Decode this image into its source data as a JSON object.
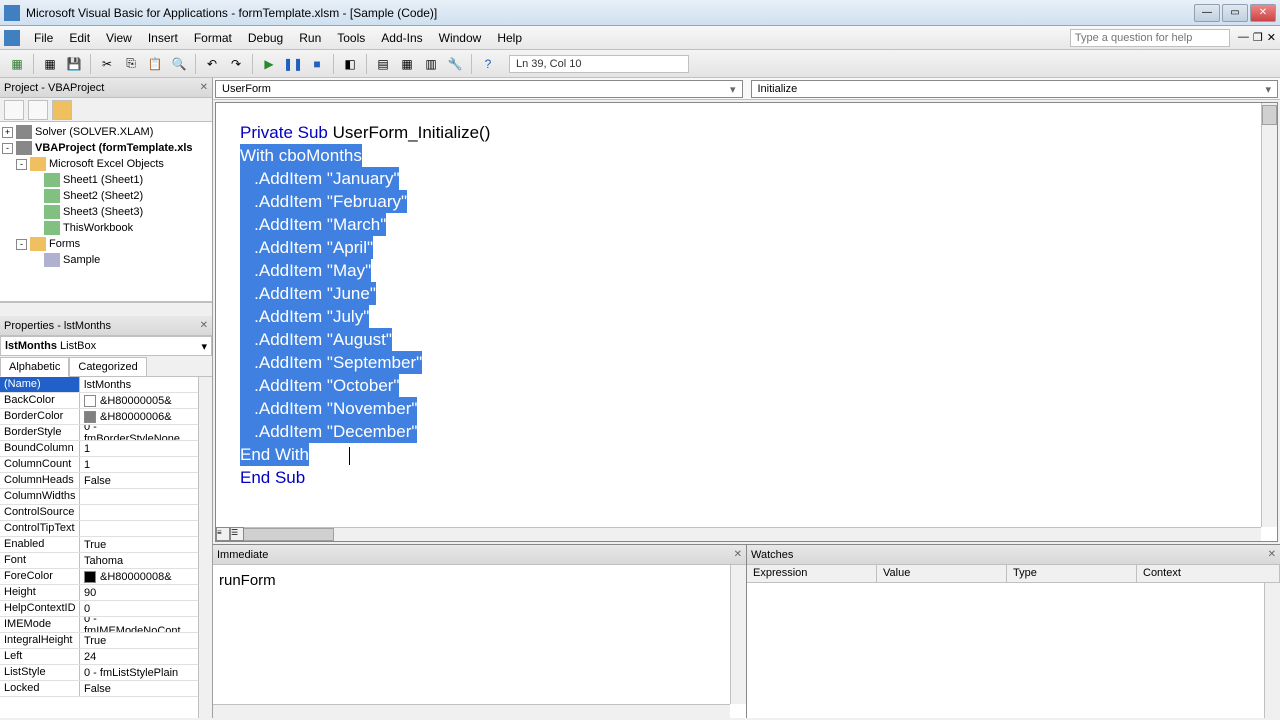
{
  "title": "Microsoft Visual Basic for Applications - formTemplate.xlsm - [Sample (Code)]",
  "menu": [
    "File",
    "Edit",
    "View",
    "Insert",
    "Format",
    "Debug",
    "Run",
    "Tools",
    "Add-Ins",
    "Window",
    "Help"
  ],
  "help_placeholder": "Type a question for help",
  "status": "Ln 39, Col 10",
  "project_panel": {
    "title": "Project - VBAProject"
  },
  "tree": [
    {
      "label": "Solver (SOLVER.XLAM)",
      "icon": "vba",
      "indent": 0,
      "exp": "+"
    },
    {
      "label": "VBAProject (formTemplate.xls",
      "icon": "vba",
      "indent": 0,
      "exp": "-",
      "bold": true
    },
    {
      "label": "Microsoft Excel Objects",
      "icon": "folder",
      "indent": 1,
      "exp": "-"
    },
    {
      "label": "Sheet1 (Sheet1)",
      "icon": "sheet",
      "indent": 2
    },
    {
      "label": "Sheet2 (Sheet2)",
      "icon": "sheet",
      "indent": 2
    },
    {
      "label": "Sheet3 (Sheet3)",
      "icon": "sheet",
      "indent": 2
    },
    {
      "label": "ThisWorkbook",
      "icon": "sheet",
      "indent": 2
    },
    {
      "label": "Forms",
      "icon": "folder",
      "indent": 1,
      "exp": "-"
    },
    {
      "label": "Sample",
      "icon": "form",
      "indent": 2
    }
  ],
  "props_panel": {
    "title": "Properties - lstMonths",
    "object": "lstMonths",
    "type": "ListBox"
  },
  "props_tabs": [
    "Alphabetic",
    "Categorized"
  ],
  "properties": [
    {
      "name": "(Name)",
      "value": "lstMonths",
      "selected": true
    },
    {
      "name": "BackColor",
      "value": "&H80000005&",
      "color": "#ffffff"
    },
    {
      "name": "BorderColor",
      "value": "&H80000006&",
      "color": "#808080"
    },
    {
      "name": "BorderStyle",
      "value": "0 - fmBorderStyleNone"
    },
    {
      "name": "BoundColumn",
      "value": "1"
    },
    {
      "name": "ColumnCount",
      "value": "1"
    },
    {
      "name": "ColumnHeads",
      "value": "False"
    },
    {
      "name": "ColumnWidths",
      "value": ""
    },
    {
      "name": "ControlSource",
      "value": ""
    },
    {
      "name": "ControlTipText",
      "value": ""
    },
    {
      "name": "Enabled",
      "value": "True"
    },
    {
      "name": "Font",
      "value": "Tahoma"
    },
    {
      "name": "ForeColor",
      "value": "&H80000008&",
      "color": "#000000"
    },
    {
      "name": "Height",
      "value": "90"
    },
    {
      "name": "HelpContextID",
      "value": "0"
    },
    {
      "name": "IMEMode",
      "value": "0 - fmIMEModeNoCont"
    },
    {
      "name": "IntegralHeight",
      "value": "True"
    },
    {
      "name": "Left",
      "value": "24"
    },
    {
      "name": "ListStyle",
      "value": "0 - fmListStylePlain"
    },
    {
      "name": "Locked",
      "value": "False"
    }
  ],
  "code_combos": {
    "object": "UserForm",
    "proc": "Initialize"
  },
  "code": {
    "first": {
      "pre": "Private Sub",
      "name": " UserForm_Initialize()"
    },
    "with": {
      "pre": "With",
      "rest": " cboMonths"
    },
    "items": [
      ".AddItem \"January\"",
      ".AddItem \"February\"",
      ".AddItem \"March\"",
      ".AddItem \"April\"",
      ".AddItem \"May\"",
      ".AddItem \"June\"",
      ".AddItem \"July\"",
      ".AddItem \"August\"",
      ".AddItem \"September\"",
      ".AddItem \"October\"",
      ".AddItem \"November\"",
      ".AddItem \"December\""
    ],
    "endwith": "End With",
    "endsub": "End Sub"
  },
  "immediate": {
    "title": "Immediate",
    "content": "runForm"
  },
  "watches": {
    "title": "Watches",
    "headers": [
      "Expression",
      "Value",
      "Type",
      "Context"
    ]
  }
}
